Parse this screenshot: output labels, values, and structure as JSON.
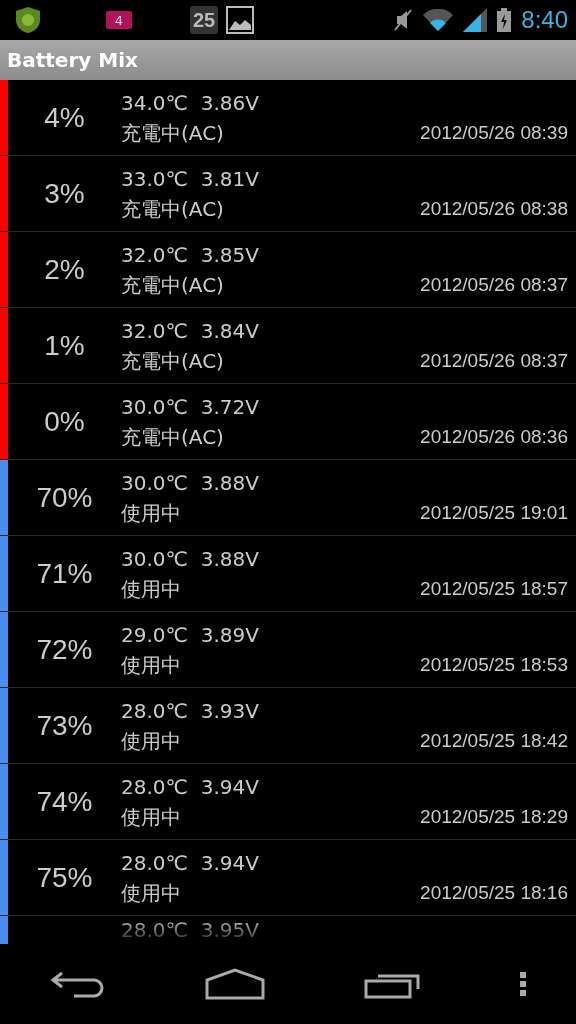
{
  "status_bar": {
    "notification_badge": "4",
    "calendar_day": "25",
    "time": "8:40"
  },
  "app_bar": {
    "title": "Battery Mix"
  },
  "rows": [
    {
      "percent": "4%",
      "reading": "34.0℃  3.86V",
      "state": "充電中(AC)",
      "time": "2012/05/26 08:39",
      "color": "#ff0000"
    },
    {
      "percent": "3%",
      "reading": "33.0℃  3.81V",
      "state": "充電中(AC)",
      "time": "2012/05/26 08:38",
      "color": "#ff0000"
    },
    {
      "percent": "2%",
      "reading": "32.0℃  3.85V",
      "state": "充電中(AC)",
      "time": "2012/05/26 08:37",
      "color": "#ff0000"
    },
    {
      "percent": "1%",
      "reading": "32.0℃  3.84V",
      "state": "充電中(AC)",
      "time": "2012/05/26 08:37",
      "color": "#ff0000"
    },
    {
      "percent": "0%",
      "reading": "30.0℃  3.72V",
      "state": "充電中(AC)",
      "time": "2012/05/26 08:36",
      "color": "#ff0000"
    },
    {
      "percent": "70%",
      "reading": "30.0℃  3.88V",
      "state": "使用中",
      "time": "2012/05/25 19:01",
      "color": "#4a8cf0"
    },
    {
      "percent": "71%",
      "reading": "30.0℃  3.88V",
      "state": "使用中",
      "time": "2012/05/25 18:57",
      "color": "#4a8cf0"
    },
    {
      "percent": "72%",
      "reading": "29.0℃  3.89V",
      "state": "使用中",
      "time": "2012/05/25 18:53",
      "color": "#4a8cf0"
    },
    {
      "percent": "73%",
      "reading": "28.0℃  3.93V",
      "state": "使用中",
      "time": "2012/05/25 18:42",
      "color": "#4a8cf0"
    },
    {
      "percent": "74%",
      "reading": "28.0℃  3.94V",
      "state": "使用中",
      "time": "2012/05/25 18:29",
      "color": "#4a8cf0"
    },
    {
      "percent": "75%",
      "reading": "28.0℃  3.94V",
      "state": "使用中",
      "time": "2012/05/25 18:16",
      "color": "#4a8cf0"
    },
    {
      "reading": "28.0℃  3.95V",
      "color": "#4a8cf0"
    }
  ]
}
